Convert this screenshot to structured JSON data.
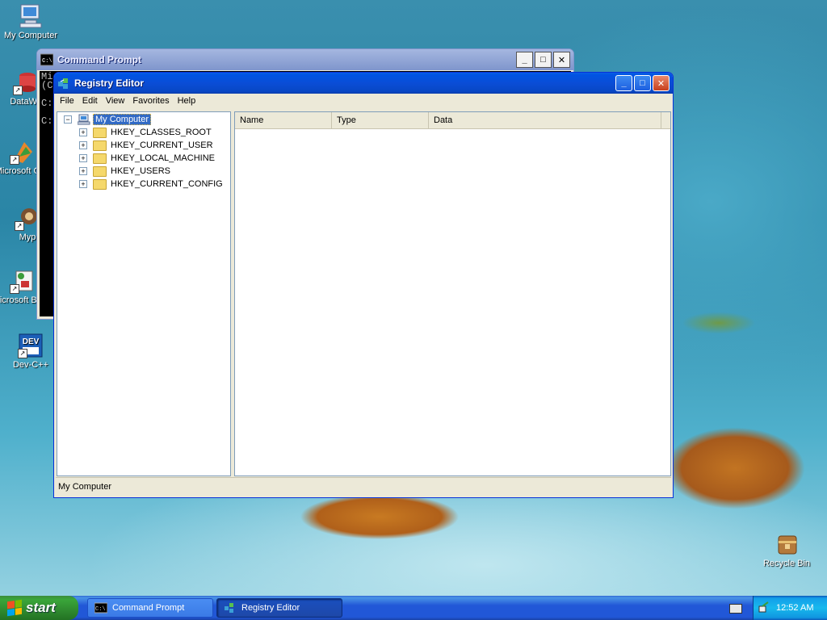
{
  "desktop": {
    "icons": [
      {
        "label": "My Computer"
      },
      {
        "label": "DataWa"
      },
      {
        "label": "Microsoft C++"
      },
      {
        "label": "Myp"
      },
      {
        "label": "Microsoft Basic"
      },
      {
        "label": "Dev-C++"
      },
      {
        "label": "Recycle Bin"
      }
    ]
  },
  "cmd_window": {
    "title": "Command Prompt",
    "lines": [
      "Mi",
      "(C",
      "",
      "C:",
      "",
      "C:"
    ]
  },
  "regedit": {
    "title": "Registry Editor",
    "menu": [
      "File",
      "Edit",
      "View",
      "Favorites",
      "Help"
    ],
    "tree": {
      "root": "My Computer",
      "children": [
        "HKEY_CLASSES_ROOT",
        "HKEY_CURRENT_USER",
        "HKEY_LOCAL_MACHINE",
        "HKEY_USERS",
        "HKEY_CURRENT_CONFIG"
      ]
    },
    "columns": [
      "Name",
      "Type",
      "Data"
    ],
    "status": "My Computer"
  },
  "taskbar": {
    "start_label": "start",
    "tasks": [
      {
        "label": "Command Prompt",
        "active": false
      },
      {
        "label": "Registry Editor",
        "active": true
      }
    ],
    "clock": "12:52 AM"
  },
  "colors": {
    "xp_blue": "#0054e3",
    "start_green": "#3aa63a",
    "selection": "#316ac5"
  }
}
